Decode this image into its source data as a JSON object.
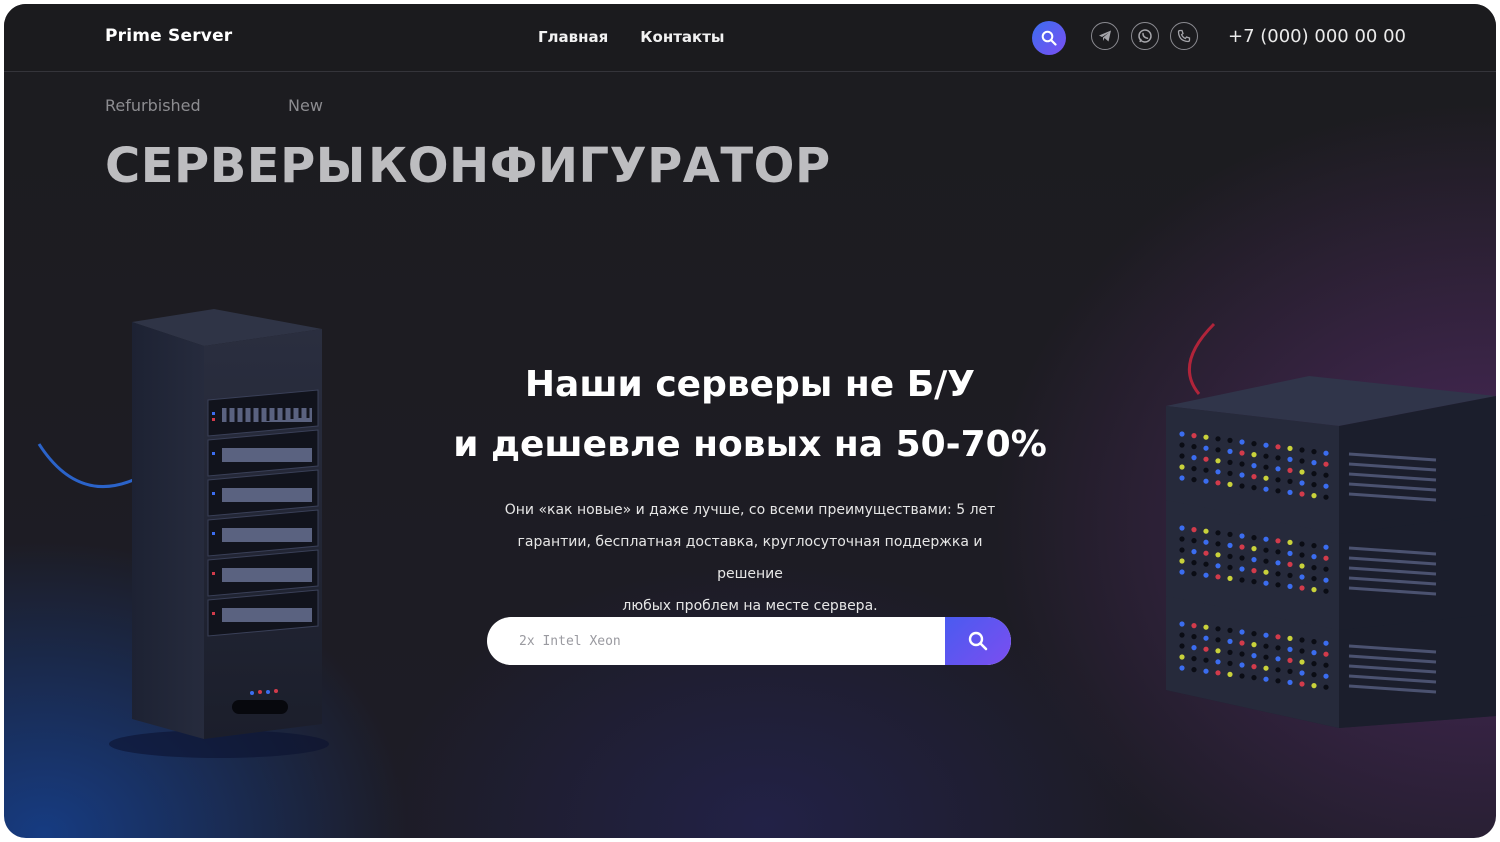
{
  "header": {
    "logo": "Prime Server",
    "nav": [
      {
        "label": "Главная"
      },
      {
        "label": "Контакты"
      }
    ],
    "phone": "+7 (000) 000 00 00",
    "icons": [
      "search-icon",
      "telegram-icon",
      "whatsapp-icon",
      "phone-icon"
    ]
  },
  "tabs": [
    {
      "caption": "Refurbished",
      "title": "СЕРВЕРЫ"
    },
    {
      "caption": "New",
      "title": "КОНФИГУРАТОР"
    }
  ],
  "hero": {
    "headline_line1": "Наши серверы не Б/У",
    "headline_line2": "и дешевле новых на 50-70%",
    "description_line1": "Они «как новые» и даже лучше, со всеми преимуществами: 5 лет",
    "description_line2": "гарантии, бесплатная доставка, круглосуточная поддержка и решение",
    "description_line3": "любых проблем на месте сервера."
  },
  "search": {
    "placeholder": "2x Intel Xeon",
    "value": ""
  },
  "colors": {
    "accent_start": "#3b6df0",
    "accent_end": "#7a4ff2",
    "background": "#1c1c1f"
  }
}
